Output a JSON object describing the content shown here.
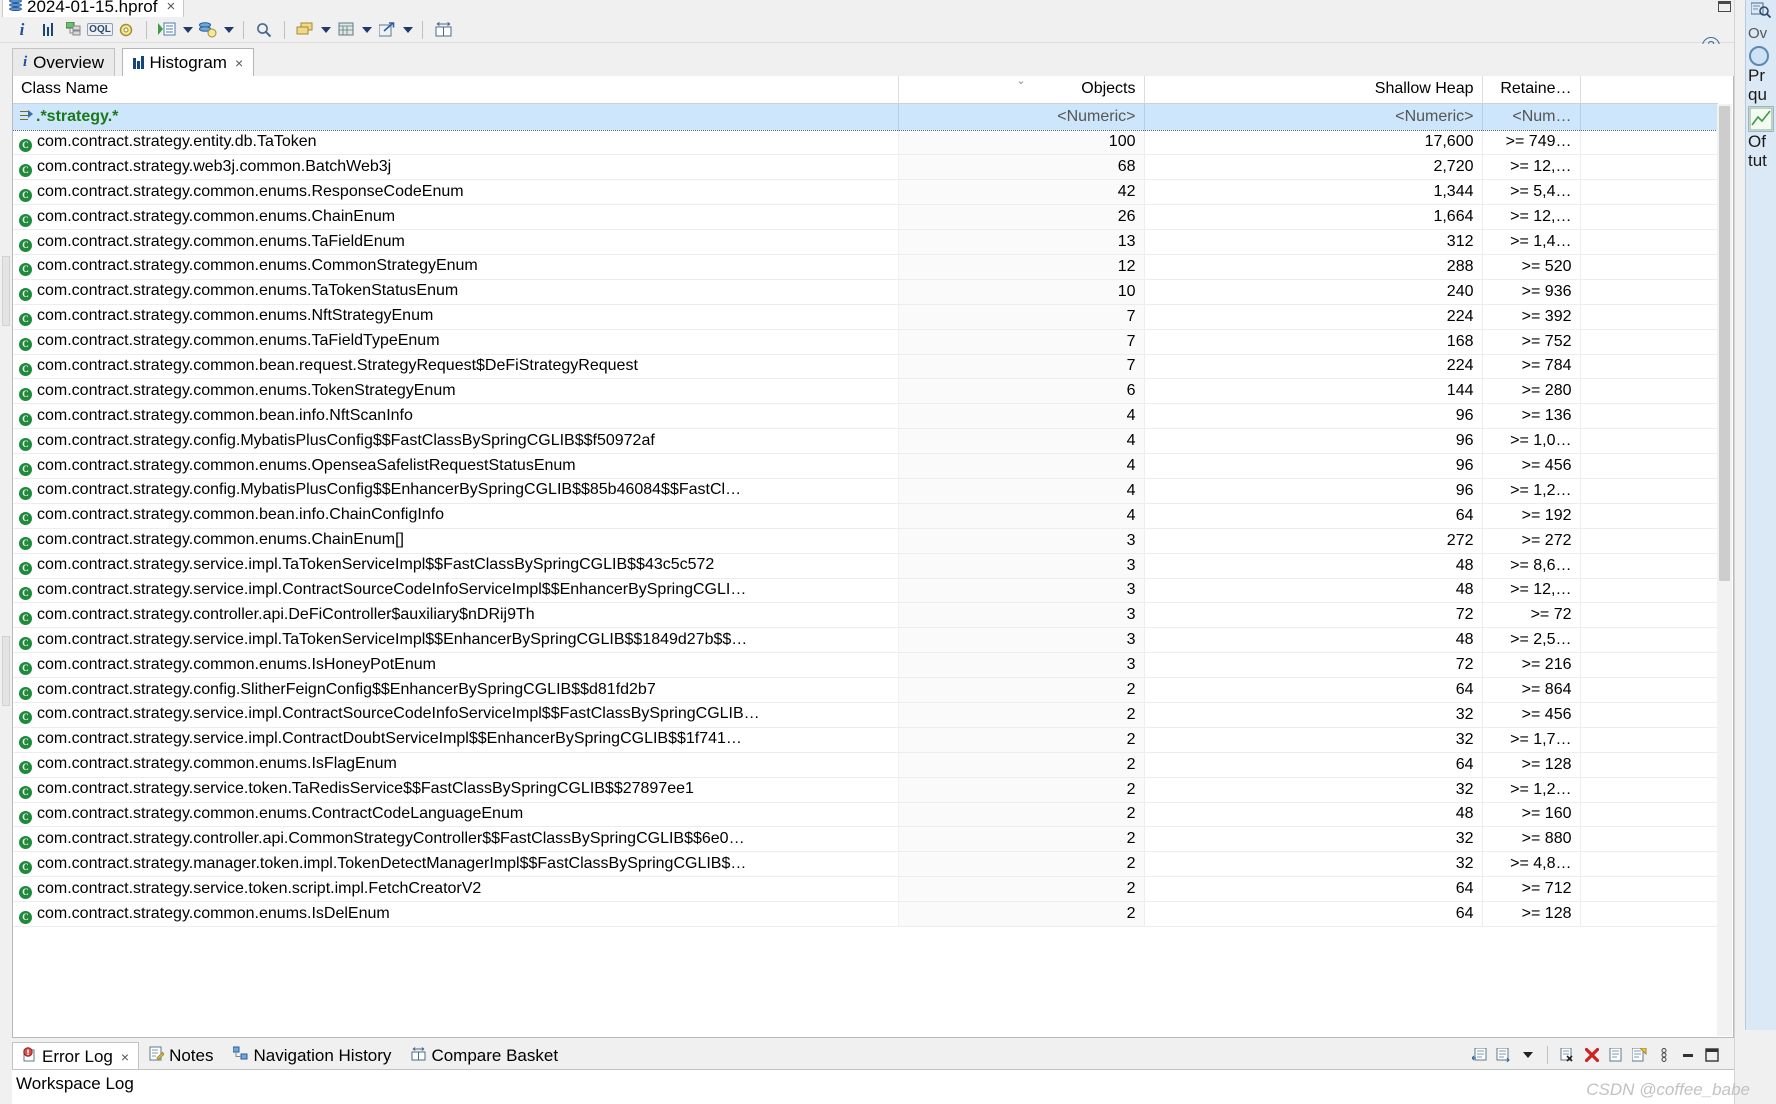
{
  "window": {
    "editor_tab": {
      "title": "2024-01-15.hprof",
      "icon": "heap-dump-icon",
      "close": "×"
    },
    "maximize_glyph": "restore-icon",
    "help_glyph": "?"
  },
  "toolbar": {
    "items": [
      {
        "name": "overview-info-icon",
        "glyph": "i"
      },
      {
        "name": "histogram-icon",
        "glyph": "bars"
      },
      {
        "name": "dominator-tree-icon",
        "glyph": "tree"
      },
      {
        "name": "oql-icon",
        "glyph": "OQL"
      },
      {
        "name": "settings-icon",
        "glyph": "gear"
      },
      {
        "name": "run-expert-system-icon",
        "glyph": "run-list"
      },
      {
        "name": "run-expert-system-dropdown",
        "glyph": "arrow"
      },
      {
        "name": "query-browser-icon",
        "glyph": "db-gear"
      },
      {
        "name": "query-browser-dropdown",
        "glyph": "arrow"
      },
      {
        "name": "find-icon",
        "glyph": "magnifier"
      },
      {
        "name": "group-by-icon",
        "glyph": "stack"
      },
      {
        "name": "group-by-dropdown",
        "glyph": "arrow"
      },
      {
        "name": "calculate-icon",
        "glyph": "grid"
      },
      {
        "name": "calculate-dropdown",
        "glyph": "arrow"
      },
      {
        "name": "export-icon",
        "glyph": "export"
      },
      {
        "name": "export-dropdown",
        "glyph": "arrow"
      },
      {
        "name": "compare-icon",
        "glyph": "compare"
      }
    ]
  },
  "view_tabs": [
    {
      "label": "Overview",
      "icon": "info-icon",
      "active": false,
      "closable": false
    },
    {
      "label": "Histogram",
      "icon": "histogram-icon",
      "active": true,
      "closable": true
    }
  ],
  "table": {
    "columns": [
      {
        "key": "name",
        "label": "Class Name",
        "align": "left",
        "sorted": false
      },
      {
        "key": "objects",
        "label": "Objects",
        "align": "right",
        "sorted": true
      },
      {
        "key": "shallow",
        "label": "Shallow Heap",
        "align": "right",
        "sorted": false
      },
      {
        "key": "retained",
        "label": "Retaine…",
        "align": "right",
        "sorted": false
      }
    ],
    "filter_row": {
      "name": ".*strategy.*",
      "objects": "<Numeric>",
      "shallow": "<Numeric>",
      "retained": "<Num…"
    },
    "rows": [
      {
        "name": "com.contract.strategy.entity.db.TaToken",
        "objects": "100",
        "shallow": "17,600",
        "retained": ">= 749…"
      },
      {
        "name": "com.contract.strategy.web3j.common.BatchWeb3j",
        "objects": "68",
        "shallow": "2,720",
        "retained": ">= 12,…"
      },
      {
        "name": "com.contract.strategy.common.enums.ResponseCodeEnum",
        "objects": "42",
        "shallow": "1,344",
        "retained": ">= 5,4…"
      },
      {
        "name": "com.contract.strategy.common.enums.ChainEnum",
        "objects": "26",
        "shallow": "1,664",
        "retained": ">= 12,…"
      },
      {
        "name": "com.contract.strategy.common.enums.TaFieldEnum",
        "objects": "13",
        "shallow": "312",
        "retained": ">= 1,4…"
      },
      {
        "name": "com.contract.strategy.common.enums.CommonStrategyEnum",
        "objects": "12",
        "shallow": "288",
        "retained": ">= 520"
      },
      {
        "name": "com.contract.strategy.common.enums.TaTokenStatusEnum",
        "objects": "10",
        "shallow": "240",
        "retained": ">= 936"
      },
      {
        "name": "com.contract.strategy.common.enums.NftStrategyEnum",
        "objects": "7",
        "shallow": "224",
        "retained": ">= 392"
      },
      {
        "name": "com.contract.strategy.common.enums.TaFieldTypeEnum",
        "objects": "7",
        "shallow": "168",
        "retained": ">= 752"
      },
      {
        "name": "com.contract.strategy.common.bean.request.StrategyRequest$DeFiStrategyRequest",
        "objects": "7",
        "shallow": "224",
        "retained": ">= 784"
      },
      {
        "name": "com.contract.strategy.common.enums.TokenStrategyEnum",
        "objects": "6",
        "shallow": "144",
        "retained": ">= 280"
      },
      {
        "name": "com.contract.strategy.common.bean.info.NftScanInfo",
        "objects": "4",
        "shallow": "96",
        "retained": ">= 136"
      },
      {
        "name": "com.contract.strategy.config.MybatisPlusConfig$$FastClassBySpringCGLIB$$f50972af",
        "objects": "4",
        "shallow": "96",
        "retained": ">= 1,0…"
      },
      {
        "name": "com.contract.strategy.common.enums.OpenseaSafelistRequestStatusEnum",
        "objects": "4",
        "shallow": "96",
        "retained": ">= 456"
      },
      {
        "name": "com.contract.strategy.config.MybatisPlusConfig$$EnhancerBySpringCGLIB$$85b46084$$FastCl…",
        "objects": "4",
        "shallow": "96",
        "retained": ">= 1,2…"
      },
      {
        "name": "com.contract.strategy.common.bean.info.ChainConfigInfo",
        "objects": "4",
        "shallow": "64",
        "retained": ">= 192"
      },
      {
        "name": "com.contract.strategy.common.enums.ChainEnum[]",
        "objects": "3",
        "shallow": "272",
        "retained": ">= 272"
      },
      {
        "name": "com.contract.strategy.service.impl.TaTokenServiceImpl$$FastClassBySpringCGLIB$$43c5c572",
        "objects": "3",
        "shallow": "48",
        "retained": ">= 8,6…"
      },
      {
        "name": "com.contract.strategy.service.impl.ContractSourceCodeInfoServiceImpl$$EnhancerBySpringCGLI…",
        "objects": "3",
        "shallow": "48",
        "retained": ">= 12,…"
      },
      {
        "name": "com.contract.strategy.controller.api.DeFiController$auxiliary$nDRij9Th",
        "objects": "3",
        "shallow": "72",
        "retained": ">= 72"
      },
      {
        "name": "com.contract.strategy.service.impl.TaTokenServiceImpl$$EnhancerBySpringCGLIB$$1849d27b$$…",
        "objects": "3",
        "shallow": "48",
        "retained": ">= 2,5…"
      },
      {
        "name": "com.contract.strategy.common.enums.IsHoneyPotEnum",
        "objects": "3",
        "shallow": "72",
        "retained": ">= 216"
      },
      {
        "name": "com.contract.strategy.config.SlitherFeignConfig$$EnhancerBySpringCGLIB$$d81fd2b7",
        "objects": "2",
        "shallow": "64",
        "retained": ">= 864"
      },
      {
        "name": "com.contract.strategy.service.impl.ContractSourceCodeInfoServiceImpl$$FastClassBySpringCGLIB…",
        "objects": "2",
        "shallow": "32",
        "retained": ">= 456"
      },
      {
        "name": "com.contract.strategy.service.impl.ContractDoubtServiceImpl$$EnhancerBySpringCGLIB$$1f741…",
        "objects": "2",
        "shallow": "32",
        "retained": ">= 1,7…"
      },
      {
        "name": "com.contract.strategy.common.enums.IsFlagEnum",
        "objects": "2",
        "shallow": "64",
        "retained": ">= 128"
      },
      {
        "name": "com.contract.strategy.service.token.TaRedisService$$FastClassBySpringCGLIB$$27897ee1",
        "objects": "2",
        "shallow": "32",
        "retained": ">= 1,2…"
      },
      {
        "name": "com.contract.strategy.common.enums.ContractCodeLanguageEnum",
        "objects": "2",
        "shallow": "48",
        "retained": ">= 160"
      },
      {
        "name": "com.contract.strategy.controller.api.CommonStrategyController$$FastClassBySpringCGLIB$$6e0…",
        "objects": "2",
        "shallow": "32",
        "retained": ">= 880"
      },
      {
        "name": "com.contract.strategy.manager.token.impl.TokenDetectManagerImpl$$FastClassBySpringCGLIB$…",
        "objects": "2",
        "shallow": "32",
        "retained": ">= 4,8…"
      },
      {
        "name": "com.contract.strategy.service.token.script.impl.FetchCreatorV2",
        "objects": "2",
        "shallow": "64",
        "retained": ">= 712"
      },
      {
        "name": "com.contract.strategy.common.enums.IsDelEnum",
        "objects": "2",
        "shallow": "64",
        "retained": ">= 128"
      }
    ]
  },
  "bottom": {
    "tabs": [
      {
        "label": "Error Log",
        "icon": "error-log-icon",
        "active": true,
        "closable": true
      },
      {
        "label": "Notes",
        "icon": "notes-icon",
        "active": false,
        "closable": false
      },
      {
        "label": "Navigation History",
        "icon": "navigation-history-icon",
        "active": false,
        "closable": false
      },
      {
        "label": "Compare Basket",
        "icon": "compare-basket-icon",
        "active": false,
        "closable": false
      }
    ],
    "content": "Workspace Log",
    "toolbar": [
      {
        "name": "restore-log-icon",
        "glyph": "import"
      },
      {
        "name": "export-log-icon",
        "glyph": "export"
      },
      {
        "name": "view-menu-dropdown",
        "glyph": "arrow"
      },
      {
        "name": "delete-log-icon",
        "glyph": "delete-doc"
      },
      {
        "name": "clear-log-icon",
        "glyph": "x"
      },
      {
        "name": "open-log-icon",
        "glyph": "doc"
      },
      {
        "name": "event-details-icon",
        "glyph": "props"
      },
      {
        "name": "view-menu-icon",
        "glyph": "kebab"
      },
      {
        "name": "minimize-icon",
        "glyph": "minimize"
      },
      {
        "name": "maximize-icon",
        "glyph": "maximize"
      }
    ]
  },
  "right_panel": {
    "search_icon": "search-icon",
    "lines": [
      "Ov",
      "Pr",
      "qu",
      "Of",
      "tut"
    ]
  },
  "watermark": "CSDN @coffee_babe",
  "colors": {
    "selection": "#cde6fb",
    "filter_text": "#1a7a1a",
    "class_icon": "#1f8a3c",
    "chrome": "#f0f0f0",
    "right_panel": "#dbe8f6"
  }
}
